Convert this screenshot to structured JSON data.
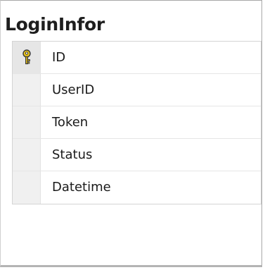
{
  "table": {
    "title": "LoginInfor",
    "columns": [
      {
        "name": "ID",
        "primary_key": true
      },
      {
        "name": "UserID",
        "primary_key": false
      },
      {
        "name": "Token",
        "primary_key": false
      },
      {
        "name": "Status",
        "primary_key": false
      },
      {
        "name": "Datetime",
        "primary_key": false
      }
    ],
    "key_icon": "primary-key-icon",
    "colors": {
      "key_gold": "#e8c21a",
      "key_outline": "#3a3a3a"
    }
  }
}
